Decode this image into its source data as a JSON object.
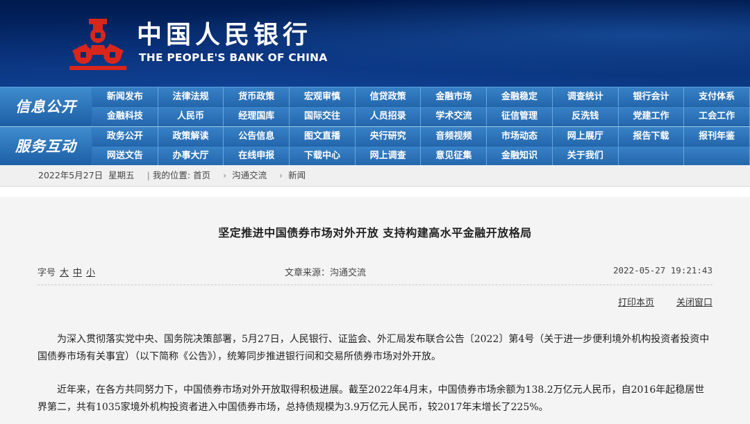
{
  "header": {
    "bank_name_cn": "中国人民银行",
    "bank_name_en": "THE PEOPLE'S BANK OF CHINA",
    "logo_icon": "pboc-emblem-icon",
    "colors": {
      "banner": "#062b6e",
      "logo_red": "#d9261c",
      "nav": "#2c76ba"
    }
  },
  "nav": {
    "groups": [
      {
        "title": "信息公开",
        "items": [
          "新闻发布",
          "法律法规",
          "货币政策",
          "宏观审慎",
          "信贷政策",
          "金融市场",
          "金融稳定",
          "调查统计",
          "银行会计",
          "支付体系",
          "金融科技",
          "人民币",
          "经理国库",
          "国际交往",
          "人员招录",
          "学术交流",
          "征信管理",
          "反洗钱",
          "党建工作",
          "工会工作"
        ]
      },
      {
        "title": "服务互动",
        "items": [
          "政务公开",
          "政策解读",
          "公告信息",
          "图文直播",
          "央行研究",
          "音频视频",
          "市场动态",
          "网上展厅",
          "报告下载",
          "报刊年鉴",
          "网送文告",
          "办事大厅",
          "在线申报",
          "下载中心",
          "网上调查",
          "意见征集",
          "金融知识",
          "关于我们",
          "",
          ""
        ]
      }
    ]
  },
  "breadcrumb": {
    "date": "2022年5月27日",
    "weekday": "星期五",
    "sep_bar": "|",
    "location_label": "我的位置:",
    "items": [
      "首页",
      "沟通交流",
      "新闻"
    ],
    "arrow": "›"
  },
  "article": {
    "title": "坚定推进中国债券市场对外开放 支持构建高水平金融开放格局",
    "font_size_label": "字号",
    "font_sizes": [
      "大",
      "中",
      "小"
    ],
    "source": "文章来源：沟通交流",
    "datetime": "2022-05-27 19:21:43",
    "print": "打印本页",
    "close": "关闭窗口",
    "paragraphs": [
      "为深入贯彻落实党中央、国务院决策部署，5月27日，人民银行、证监会、外汇局发布联合公告〔2022〕第4号（关于进一步便利境外机构投资者投资中国债券市场有关事宜）（以下简称《公告》），统筹同步推进银行间和交易所债券市场对外开放。",
      "近年来，在各方共同努力下，中国债券市场对外开放取得积极进展。截至2022年4月末，中国债券市场余额为138.2万亿元人民币，自2016年起稳居世界第二，共有1035家境外机构投资者进入中国债券市场，总持债规模为3.9万亿元人民币，较2017年末增长了225%。"
    ]
  }
}
